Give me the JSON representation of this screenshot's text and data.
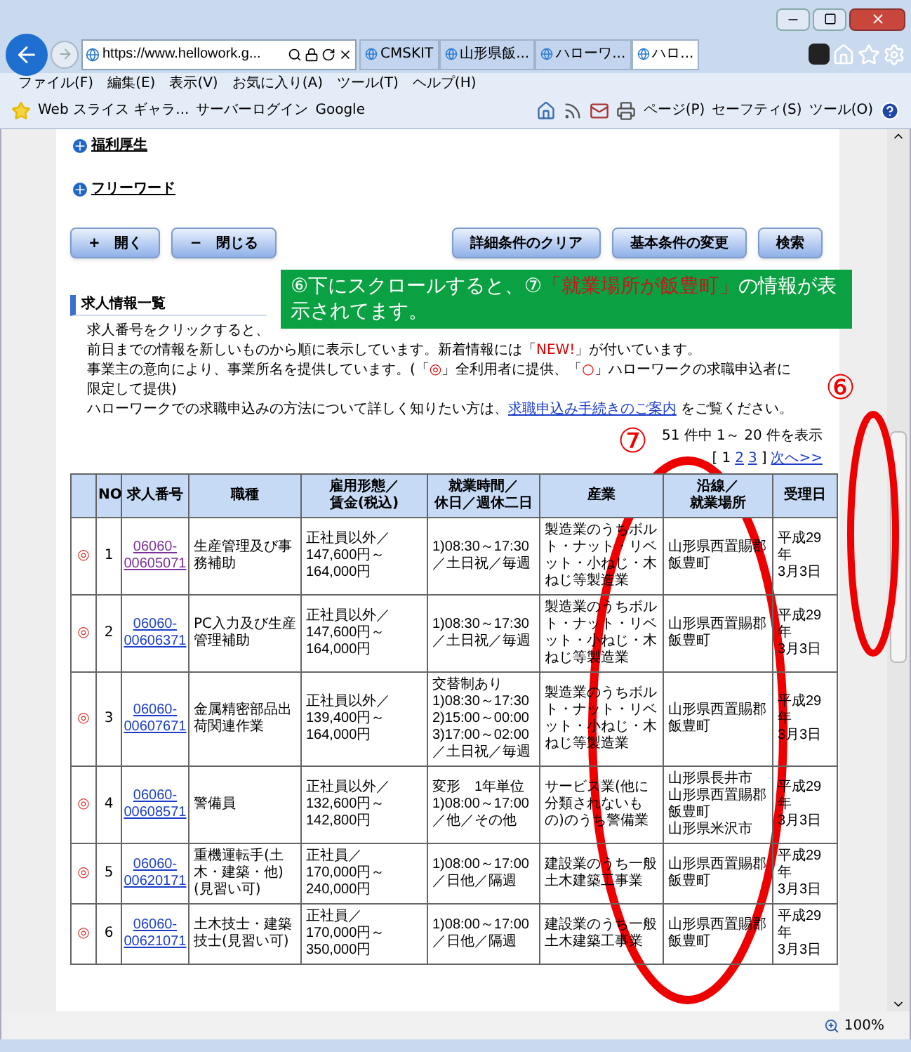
{
  "browser": {
    "address": "https://www.hellowork.g...",
    "tabs": [
      {
        "label": "CMSKIT",
        "selected": false
      },
      {
        "label": "山形県飯...",
        "selected": false
      },
      {
        "label": "ハローワ...",
        "selected": false
      },
      {
        "label": "ハロ...",
        "selected": true
      }
    ],
    "menu": [
      "ファイル(F)",
      "編集(E)",
      "表示(V)",
      "お気に入り(A)",
      "ツール(T)",
      "ヘルプ(H)"
    ],
    "favorites": [
      "Web スライス ギャラ...",
      "サーバーログイン",
      "Google"
    ],
    "commands": [
      "ページ(P)",
      "セーフティ(S)",
      "ツール(O)"
    ],
    "zoom": "100%"
  },
  "page": {
    "links": [
      "福利厚生",
      "フリーワード"
    ],
    "left_buttons": [
      "+　開く",
      "−　閉じる"
    ],
    "right_buttons": [
      "詳細条件のクリア",
      "基本条件の変更",
      "検索"
    ],
    "section_title": "求人情報一覧",
    "paragraphs": [
      [
        {
          "kind": "text",
          "text": "求人番号をクリックすると、"
        }
      ],
      [
        {
          "kind": "text",
          "text": "前日までの情報を新しいものから順に表示しています。新着情報には「"
        },
        {
          "kind": "red",
          "text": "NEW!"
        },
        {
          "kind": "text",
          "text": "」が付いています。"
        }
      ],
      [
        {
          "kind": "text",
          "text": "事業主の意向により、事業所名を提供しています。(「"
        },
        {
          "kind": "red",
          "text": "◎"
        },
        {
          "kind": "text",
          "text": "」全利用者に提供、「"
        },
        {
          "kind": "red",
          "text": "○"
        },
        {
          "kind": "text",
          "text": "」ハローワークの求職申込者に限定して提供)"
        }
      ],
      [
        {
          "kind": "text",
          "text": "ハローワークでの求職申込みの方法について詳しく知りたい方は、"
        },
        {
          "kind": "link",
          "text": "求職申込み手続きのご案内"
        },
        {
          "kind": "text",
          "text": " をご覧ください。"
        }
      ]
    ],
    "result_count": "51 件中 1～ 20 件を表示",
    "pagination": {
      "open": "[",
      "pages": [
        {
          "label": "1",
          "selected": true
        },
        {
          "label": "2",
          "selected": false
        },
        {
          "label": "3",
          "selected": false
        }
      ],
      "close": "]",
      "next": "次へ>>"
    },
    "table": {
      "columns": [
        [],
        [
          "NO"
        ],
        [
          "求人番号"
        ],
        [
          "職種"
        ],
        [
          "雇用形態／",
          "賃金(税込)"
        ],
        [
          "就業時間／",
          "休日／週休二日"
        ],
        [
          "産業"
        ],
        [
          "沿線／",
          "就業場所"
        ],
        [
          "受理日"
        ]
      ],
      "rows": [
        {
          "mark": "◎",
          "no": "1",
          "number": "06060-00605071",
          "visited": true,
          "job": "生産管理及び事務補助",
          "employment": [
            "正社員以外／",
            "147,600円～164,000円"
          ],
          "hours": [
            "1)08:30～17:30",
            "／土日祝／毎週"
          ],
          "industry": "製造業のうちボルト・ナット・リベット・小ねじ・木ねじ等製造業",
          "location": [
            "山形県西置賜郡飯豊町"
          ],
          "date": [
            "平成29年",
            "3月3日"
          ]
        },
        {
          "mark": "◎",
          "no": "2",
          "number": "06060-00606371",
          "visited": false,
          "job": "PC入力及び生産管理補助",
          "employment": [
            "正社員以外／",
            "147,600円～164,000円"
          ],
          "hours": [
            "1)08:30～17:30",
            "／土日祝／毎週"
          ],
          "industry": "製造業のうちボルト・ナット・リベット・小ねじ・木ねじ等製造業",
          "location": [
            "山形県西置賜郡飯豊町"
          ],
          "date": [
            "平成29年",
            "3月3日"
          ]
        },
        {
          "mark": "◎",
          "no": "3",
          "number": "06060-00607671",
          "visited": false,
          "job": "金属精密部品出荷関連作業",
          "employment": [
            "正社員以外／",
            "139,400円～164,000円"
          ],
          "hours": [
            "交替制あり",
            "1)08:30～17:30",
            "2)15:00～00:00",
            "3)17:00～02:00",
            "／土日祝／毎週"
          ],
          "industry": "製造業のうちボルト・ナット・リベット・小ねじ・木ねじ等製造業",
          "location": [
            "山形県西置賜郡飯豊町"
          ],
          "date": [
            "平成29年",
            "3月3日"
          ]
        },
        {
          "mark": "◎",
          "no": "4",
          "number": "06060-00608571",
          "visited": false,
          "job": "警備員",
          "employment": [
            "正社員以外／",
            "132,600円～142,800円"
          ],
          "hours": [
            "変形　1年単位",
            "1)08:00～17:00",
            "／他／その他"
          ],
          "industry": "サービス業(他に分類されないもの)のうち警備業",
          "location": [
            "山形県長井市",
            "山形県西置賜郡飯豊町",
            "山形県米沢市"
          ],
          "date": [
            "平成29年",
            "3月3日"
          ]
        },
        {
          "mark": "◎",
          "no": "5",
          "number": "06060-00620171",
          "visited": false,
          "job": "重機運転手(土木・建築・他)(見習い可)",
          "employment": [
            "正社員／",
            "170,000円～240,000円"
          ],
          "hours": [
            "1)08:00～17:00",
            "／日他／隔週"
          ],
          "industry": "建設業のうち一般土木建築工事業",
          "location": [
            "山形県西置賜郡飯豊町"
          ],
          "date": [
            "平成29年",
            "3月3日"
          ]
        },
        {
          "mark": "◎",
          "no": "6",
          "number": "06060-00621071",
          "visited": false,
          "job": "土木技士・建築技士(見習い可)",
          "employment": [
            "正社員／",
            "170,000円～350,000円"
          ],
          "hours": [
            "1)08:00～17:00",
            "／日他／隔週"
          ],
          "industry": "建設業のうち一般土木建築工事業",
          "location": [
            "山形県西置賜郡飯豊町"
          ],
          "date": [
            "平成29年",
            "3月3日"
          ]
        }
      ]
    }
  },
  "annotations": {
    "callout": [
      {
        "kind": "text",
        "text": "⑥下にスクロールすると、⑦"
      },
      {
        "kind": "red",
        "text": "「就業場所が飯豊町」"
      },
      {
        "kind": "text",
        "text": "の情報が表示されてます。"
      }
    ],
    "markers": [
      "⑥",
      "⑦"
    ]
  }
}
